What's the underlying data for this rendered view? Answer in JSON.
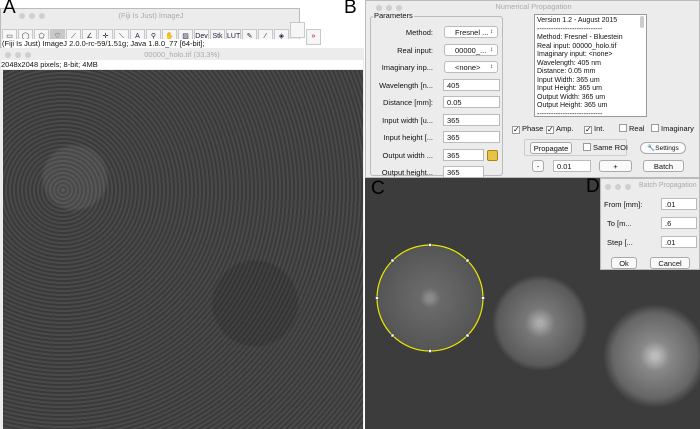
{
  "panel_labels": [
    "A",
    "B",
    "C",
    "D"
  ],
  "imagej": {
    "title": "(Fiji Is Just) ImageJ",
    "status": "(Fiji Is Just) ImageJ 2.0.0-rc-59/1.51g; Java 1.8.0_77 [64-bit];",
    "tools": [
      "rectangle-icon",
      "oval-icon",
      "polygon-icon",
      "freehand-icon",
      "line-icon",
      "angle-icon",
      "point-icon",
      "wand-icon",
      "text-icon",
      "magnifier-icon",
      "hand-icon",
      "color-picker-icon",
      "Dev",
      "Stk",
      "LUT",
      "pencil-icon",
      "brush-icon",
      "flood-fill-icon",
      "blank",
      "more-icon"
    ]
  },
  "image_window": {
    "title": "00000_holo.tif (33.3%)",
    "info": "2048x2048 pixels; 8-bit; 4MB"
  },
  "numprop": {
    "title": "Numerical Propagation",
    "group": "Parameters",
    "params": [
      {
        "label": "Method:",
        "value": "Fresnel ...",
        "type": "select"
      },
      {
        "label": "Real input:",
        "value": "00000_...",
        "type": "select"
      },
      {
        "label": "Imaginary inp...",
        "value": "<none>",
        "type": "select"
      },
      {
        "label": "Wavelength [n...",
        "value": "405",
        "type": "text"
      },
      {
        "label": "Distance [mm]:",
        "value": "0.05",
        "type": "text"
      },
      {
        "label": "Input width [u...",
        "value": "365",
        "type": "text"
      },
      {
        "label": "Input height [...",
        "value": "365",
        "type": "text"
      },
      {
        "label": "Output width ...",
        "value": "365",
        "type": "text"
      },
      {
        "label": "Output height...",
        "value": "365",
        "type": "text"
      }
    ],
    "log": [
      "Version 1.2 - August 2015",
      "----------------------------",
      "Method: Fresnel - Bluestein",
      "Real input: 00000_holo.tif",
      "Imaginary input: <none>",
      "Wavelength: 405 nm",
      "Distance: 0.05 mm",
      "Input Width: 365 um",
      "Input Height: 365 um",
      "Output Width: 365 um",
      "Output Height: 365 um",
      "----------------------------"
    ],
    "checks": [
      {
        "label": "Phase",
        "checked": true
      },
      {
        "label": "Amp.",
        "checked": true
      },
      {
        "label": "Int.",
        "checked": true
      },
      {
        "label": "Real",
        "checked": false
      },
      {
        "label": "Imaginary",
        "checked": false
      }
    ],
    "propagate": "Propagate",
    "same_roi": "Same ROI",
    "settings": "Settings",
    "minus": "-",
    "step": "0.01",
    "plus": "+",
    "batch": "Batch"
  },
  "batch": {
    "title": "Batch Propagation",
    "fields": [
      {
        "label": "From [mm]:",
        "value": ".01"
      },
      {
        "label": "To [m...",
        "value": ".6"
      },
      {
        "label": "Step [...",
        "value": ".01"
      }
    ],
    "ok": "Ok",
    "cancel": "Cancel"
  },
  "colors": {
    "roi": "#e8e800"
  }
}
